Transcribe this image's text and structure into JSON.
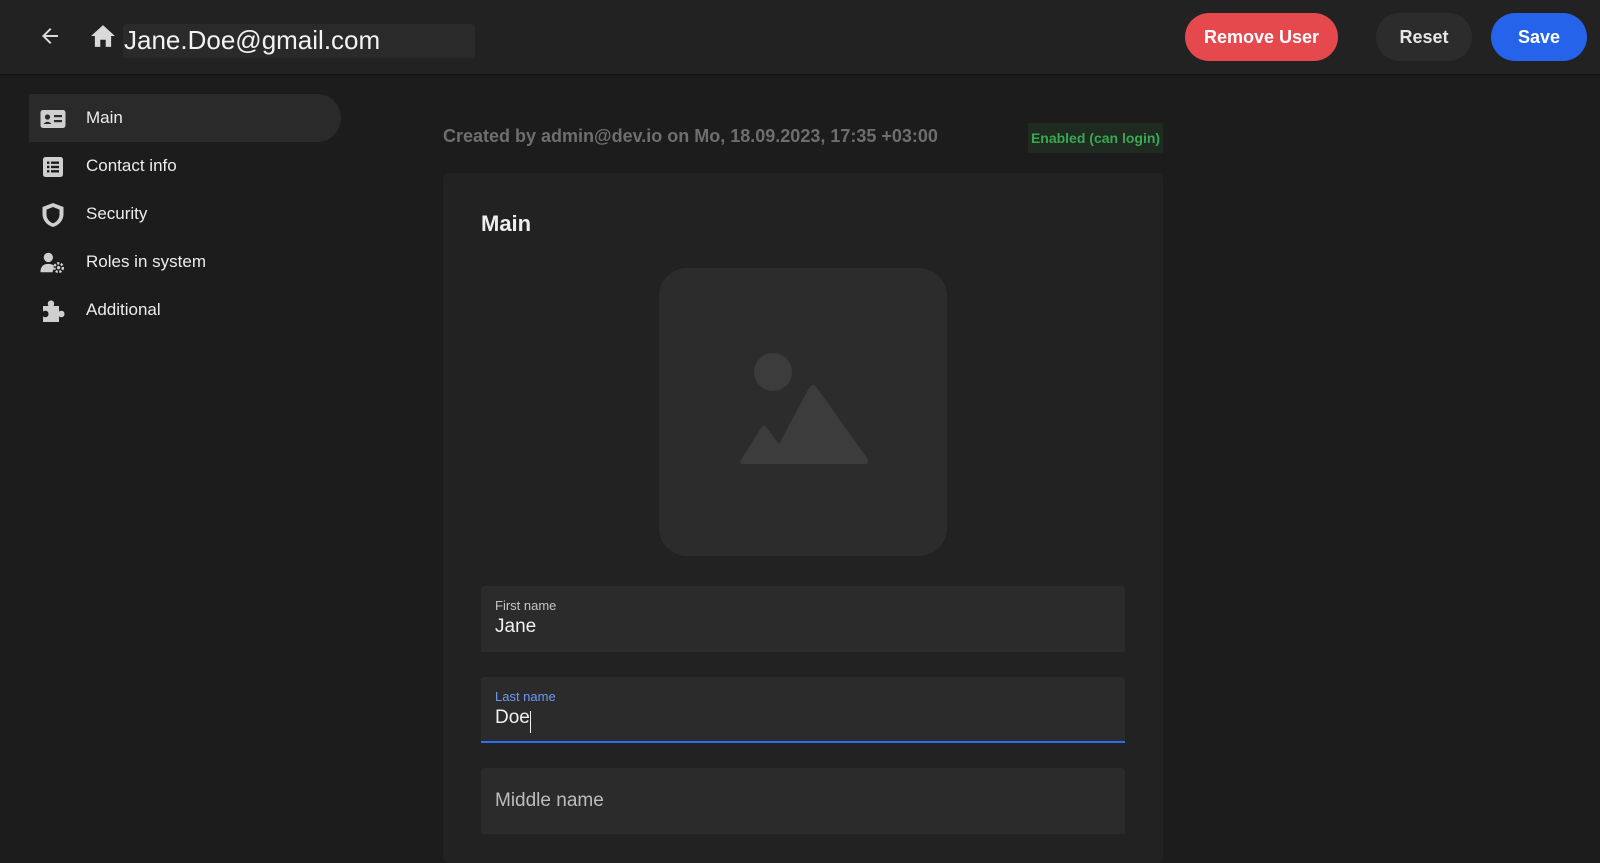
{
  "header": {
    "title": "Jane.Doe@gmail.com",
    "remove_label": "Remove User",
    "reset_label": "Reset",
    "save_label": "Save"
  },
  "sidebar": {
    "items": [
      {
        "label": "Main",
        "icon": "id-card-icon",
        "active": true
      },
      {
        "label": "Contact info",
        "icon": "list-icon",
        "active": false
      },
      {
        "label": "Security",
        "icon": "shield-icon",
        "active": false
      },
      {
        "label": "Roles in system",
        "icon": "user-gear-icon",
        "active": false
      },
      {
        "label": "Additional",
        "icon": "puzzle-icon",
        "active": false
      }
    ]
  },
  "meta": {
    "created": "Created by admin@dev.io on Mo, 18.09.2023, 17:35 +03:00",
    "status": "Enabled (can login)"
  },
  "form": {
    "section_title": "Main",
    "first_name": {
      "label": "First name",
      "value": "Jane"
    },
    "last_name": {
      "label": "Last name",
      "value": "Doe"
    },
    "middle_name": {
      "label": "Middle name",
      "value": ""
    }
  },
  "colors": {
    "danger": "#e5484d",
    "primary": "#2563eb",
    "success": "#3aa853",
    "background": "#1c1c1c"
  }
}
